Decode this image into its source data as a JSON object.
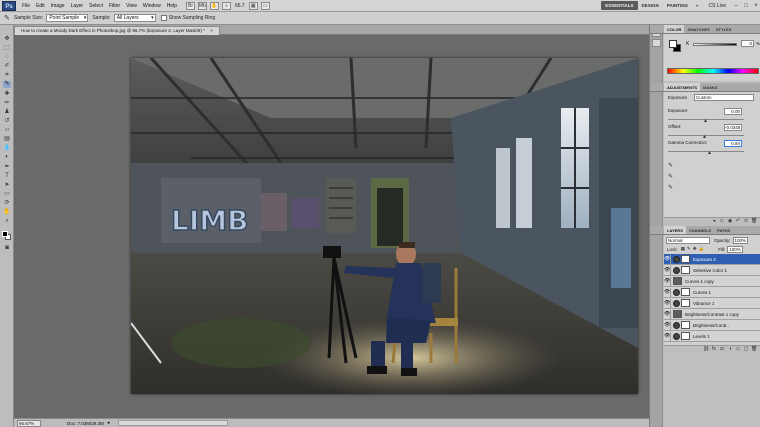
{
  "app": {
    "logo": "Ps",
    "menu": [
      "File",
      "Edit",
      "Image",
      "Layer",
      "Select",
      "Filter",
      "View",
      "Window",
      "Help"
    ],
    "zoom_display": "66.7",
    "workspaces": [
      "ESSENTIALS",
      "DESIGN",
      "PAINTING"
    ],
    "active_workspace": "ESSENTIALS",
    "cs_live": "CS Live"
  },
  "options_bar": {
    "sample_size_label": "Sample Size:",
    "sample_size_value": "Point Sample",
    "sample_label": "Sample:",
    "sample_value": "All Layers",
    "show_ring_label": "Show Sampling Ring"
  },
  "document": {
    "tab_title": "How to create a Moody Dark Effect in Photoshop.jpg @ 66.7% (Exposure 2, Layer Mask/8) *"
  },
  "status": {
    "zoom": "66.67%",
    "doc_size": "Doc: 7.03M/28.3M"
  },
  "panels": {
    "color": {
      "tabs": [
        "COLOR",
        "SWATCHES",
        "STYLES"
      ],
      "k_label": "K",
      "k_value": "0",
      "k_unit": "%"
    },
    "adjustments": {
      "tabs": [
        "ADJUSTMENTS",
        "MASKS"
      ],
      "type": "Exposure",
      "preset": "Custom",
      "exposure_label": "Exposure:",
      "exposure_value": "0.00",
      "offset_label": "Offset:",
      "offset_value": "-0.0348",
      "gamma_label": "Gamma Correction:",
      "gamma_value": "0.84"
    },
    "layers": {
      "tabs": [
        "LAYERS",
        "CHANNELS",
        "PATHS"
      ],
      "blend_mode": "Normal",
      "opacity_label": "Opacity:",
      "opacity_value": "100%",
      "lock_label": "Lock:",
      "fill_label": "Fill:",
      "fill_value": "100%",
      "items": [
        {
          "name": "Exposure 2",
          "selected": true
        },
        {
          "name": "Selective Color 1",
          "selected": false
        },
        {
          "name": "Curves 1 copy",
          "selected": false
        },
        {
          "name": "Curves 1",
          "selected": false
        },
        {
          "name": "Vibrance 1",
          "selected": false
        },
        {
          "name": "Brightness/Contrast 1 copy",
          "selected": false
        },
        {
          "name": "Brightness/Contr...",
          "selected": false
        },
        {
          "name": "Levels 1",
          "selected": false
        }
      ]
    }
  },
  "colors": {
    "selected_layer": "#2f5fb0",
    "active_workspace_bg": "#5a5a5a"
  }
}
